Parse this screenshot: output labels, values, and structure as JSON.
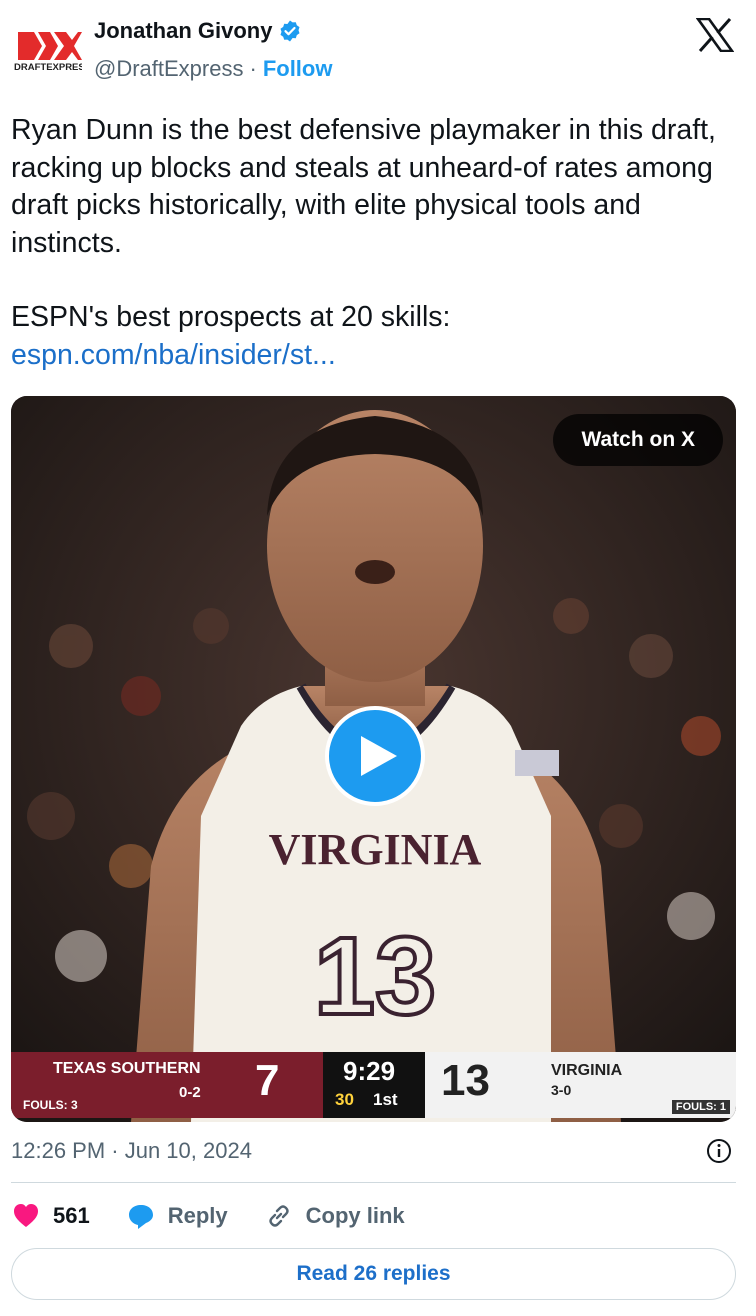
{
  "author": {
    "name": "Jonathan Givony",
    "handle": "@DraftExpress",
    "separator": "·",
    "follow_label": "Follow",
    "logo_text": "DRAFTEXPRESS",
    "verified_color": "#1d9bf0"
  },
  "tweet": {
    "paragraph1": "Ryan Dunn is the best defensive playmaker in this draft, racking up blocks and steals at unheard-of rates among draft picks historically, with elite physical tools and instincts.",
    "paragraph2": "ESPN's best prospects at 20 skills:",
    "link": "espn.com/nba/insider/st..."
  },
  "media": {
    "watch_label": "Watch on X",
    "jersey_text": "VIRGINIA",
    "jersey_number": "13",
    "scoreboard": {
      "away_team": "TEXAS SOUTHERN",
      "away_record": "0-2",
      "away_fouls": "FOULS: 3",
      "away_score": "7",
      "clock": "9:29",
      "shot_clock": "30",
      "period": "1st",
      "home_score": "13",
      "home_team": "VIRGINIA",
      "home_record": "3-0",
      "home_fouls": "FOULS: 1"
    }
  },
  "meta": {
    "timestamp": "12:26 PM · Jun 10, 2024"
  },
  "actions": {
    "like_count": "561",
    "reply_label": "Reply",
    "copy_label": "Copy link",
    "read_replies_label": "Read 26 replies"
  },
  "colors": {
    "accent": "#1d9bf0",
    "heart": "#f91880",
    "text": "#0f1419",
    "muted": "#536471"
  }
}
